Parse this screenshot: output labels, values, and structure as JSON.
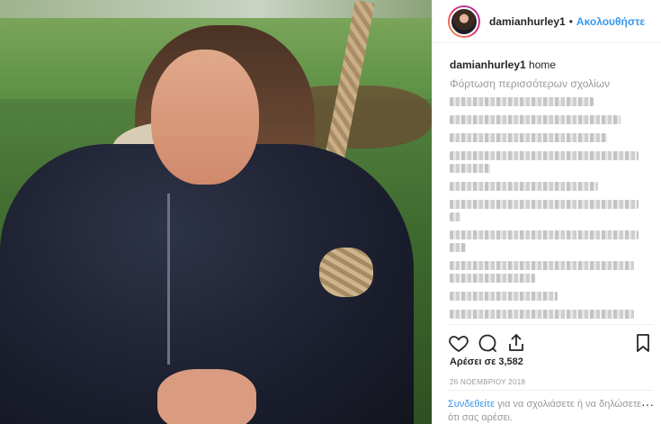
{
  "post": {
    "username": "damianhurley1",
    "follow_label": "Ακολουθήστε",
    "caption_username": "damianhurley1",
    "caption_text": "home",
    "load_more": "Φόρτωση περισσότερων σχολίων",
    "likes_text": "Αρέσει σε 3,582",
    "date": "26 ΝΟΕΜΒΡΙΟΥ 2018",
    "login_link": "Συνδεθείτε",
    "login_text": " για να σχολιάσετε ή να δηλώσετε ότι σας αρέσει.",
    "more_options": "···"
  },
  "icons": {
    "like": "heart-icon",
    "comment": "comment-icon",
    "share": "share-icon",
    "save": "bookmark-icon"
  },
  "colors": {
    "accent": "#3897f0",
    "muted": "#999999",
    "border": "#efefef"
  }
}
